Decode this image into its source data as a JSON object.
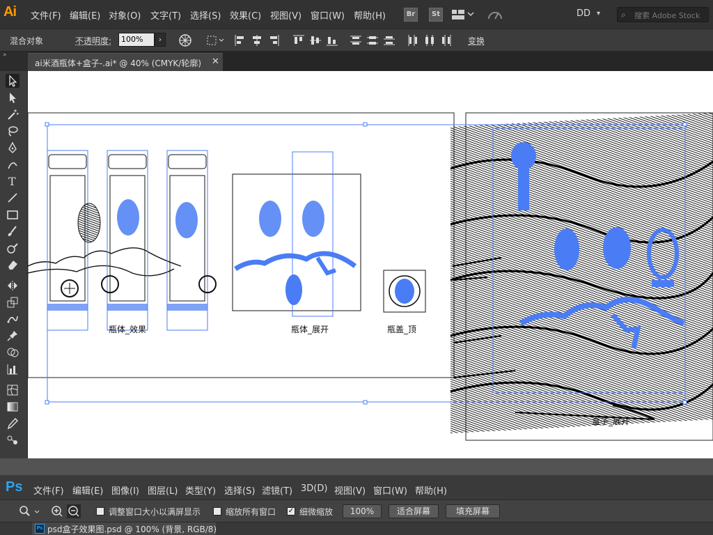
{
  "illustrator": {
    "logo": "Ai",
    "menus": [
      "文件(F)",
      "编辑(E)",
      "对象(O)",
      "文字(T)",
      "选择(S)",
      "效果(C)",
      "视图(V)",
      "窗口(W)",
      "帮助(H)"
    ],
    "bridge_label": "Br",
    "stock_label": "St",
    "workspace": "DD",
    "search_placeholder": "搜索 Adobe Stock",
    "control": {
      "selection_label": "混合对象",
      "opacity_label": "不透明度:",
      "opacity_value": "100%",
      "transform_label": "变换"
    },
    "document_tab": "ai米酒瓶体+盒子-.ai* @ 40% (CMYK/轮廓)",
    "artboard_labels": {
      "bottle_effect": "瓶体_效果",
      "bottle_unfold": "瓶体_展开",
      "cap_top": "瓶盖_顶",
      "box_unfold": "盒子_展开"
    },
    "colors": {
      "selection": "#4a7cf5",
      "canvas": "#ffffff"
    }
  },
  "photoshop": {
    "logo": "Ps",
    "menus": [
      "文件(F)",
      "编辑(E)",
      "图像(I)",
      "图层(L)",
      "类型(Y)",
      "选择(S)",
      "滤镜(T)",
      "3D(D)",
      "视图(V)",
      "窗口(W)",
      "帮助(H)"
    ],
    "options": {
      "resize_windows": "调整窗口大小以满屏显示",
      "zoom_all": "缩放所有窗口",
      "scrubby_zoom": "细微缩放",
      "zoom_value": "100%",
      "fit_screen": "适合屏幕",
      "fill_screen": "填充屏幕"
    },
    "document_tab": "psd盒子效果图.psd @ 100% (背景, RGB/8)"
  }
}
